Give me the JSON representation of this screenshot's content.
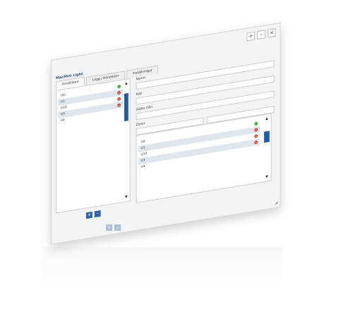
{
  "window": {
    "title": "MacMini Light",
    "controls": [
      "+",
      "–",
      "×"
    ]
  },
  "tabs": [
    {
      "label": "Användare",
      "active": true
    },
    {
      "label": "Logg / Händelser",
      "active": false
    },
    {
      "label": "Inställningar",
      "active": false
    }
  ],
  "left_list": [
    {
      "label": "U0",
      "status": "ok"
    },
    {
      "label": "U1",
      "status": "error"
    },
    {
      "label": "U10",
      "status": "error"
    },
    {
      "label": "U3",
      "status": "error"
    },
    {
      "label": "U4",
      "status": "none"
    }
  ],
  "form": {
    "name_label": "Namn",
    "kod_label": "Kod",
    "valid_from_label": "Gäller från",
    "zone_label": "Zoner"
  },
  "right_list": [
    {
      "label": "U0",
      "status": "ok"
    },
    {
      "label": "U1",
      "status": "error"
    },
    {
      "label": "U10",
      "status": "error"
    },
    {
      "label": "U3",
      "status": "error"
    },
    {
      "label": "U4",
      "status": "none"
    }
  ],
  "buttons": {
    "add": "+",
    "remove": "–"
  },
  "scroll": {
    "up": "▲",
    "down": "▼"
  },
  "colors": {
    "accent": "#2a63a8",
    "ok": "#3ea33e",
    "error": "#d33a2c",
    "row_alt": "#dfe6ee"
  }
}
